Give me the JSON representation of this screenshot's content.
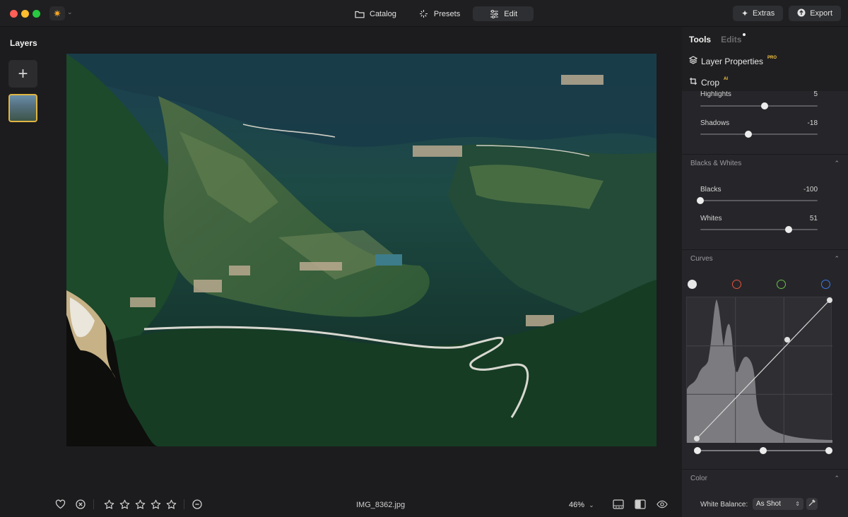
{
  "app": {
    "logo_icon": "sun-icon",
    "accent": "#f5a623"
  },
  "toolbar": {
    "tabs": [
      {
        "label": "Catalog",
        "icon": "folder-icon"
      },
      {
        "label": "Presets",
        "icon": "sparkle-icon"
      },
      {
        "label": "Edit",
        "icon": "sliders-icon",
        "active": true
      }
    ],
    "extras_label": "Extras",
    "export_label": "Export"
  },
  "layers": {
    "title": "Layers"
  },
  "bottom_bar": {
    "rating_stars": 5,
    "rating_value": 0,
    "filename": "IMG_8362.jpg",
    "zoom": "46%"
  },
  "right_panel": {
    "tabs": {
      "tools": "Tools",
      "edits": "Edits"
    },
    "layer_properties": {
      "label": "Layer Properties",
      "badge": "PRO"
    },
    "crop": {
      "label": "Crop",
      "badge": "AI"
    },
    "light": {
      "highlights": {
        "label": "Highlights",
        "value": "5",
        "fraction": 0.55
      },
      "shadows": {
        "label": "Shadows",
        "value": "-18",
        "fraction": 0.41
      }
    },
    "blacks_whites": {
      "title": "Blacks & Whites",
      "blacks": {
        "label": "Blacks",
        "value": "-100",
        "fraction": 0.0
      },
      "whites": {
        "label": "Whites",
        "value": "51",
        "fraction": 0.755
      }
    },
    "curves": {
      "title": "Curves",
      "channels": [
        {
          "name": "luminance",
          "color": "#e8e8e8"
        },
        {
          "name": "red",
          "color": "#e5533d"
        },
        {
          "name": "green",
          "color": "#6cc04a"
        },
        {
          "name": "blue",
          "color": "#3d7ae5"
        }
      ]
    },
    "color": {
      "title": "Color",
      "white_balance_label": "White Balance:",
      "white_balance_value": "As Shot"
    }
  }
}
